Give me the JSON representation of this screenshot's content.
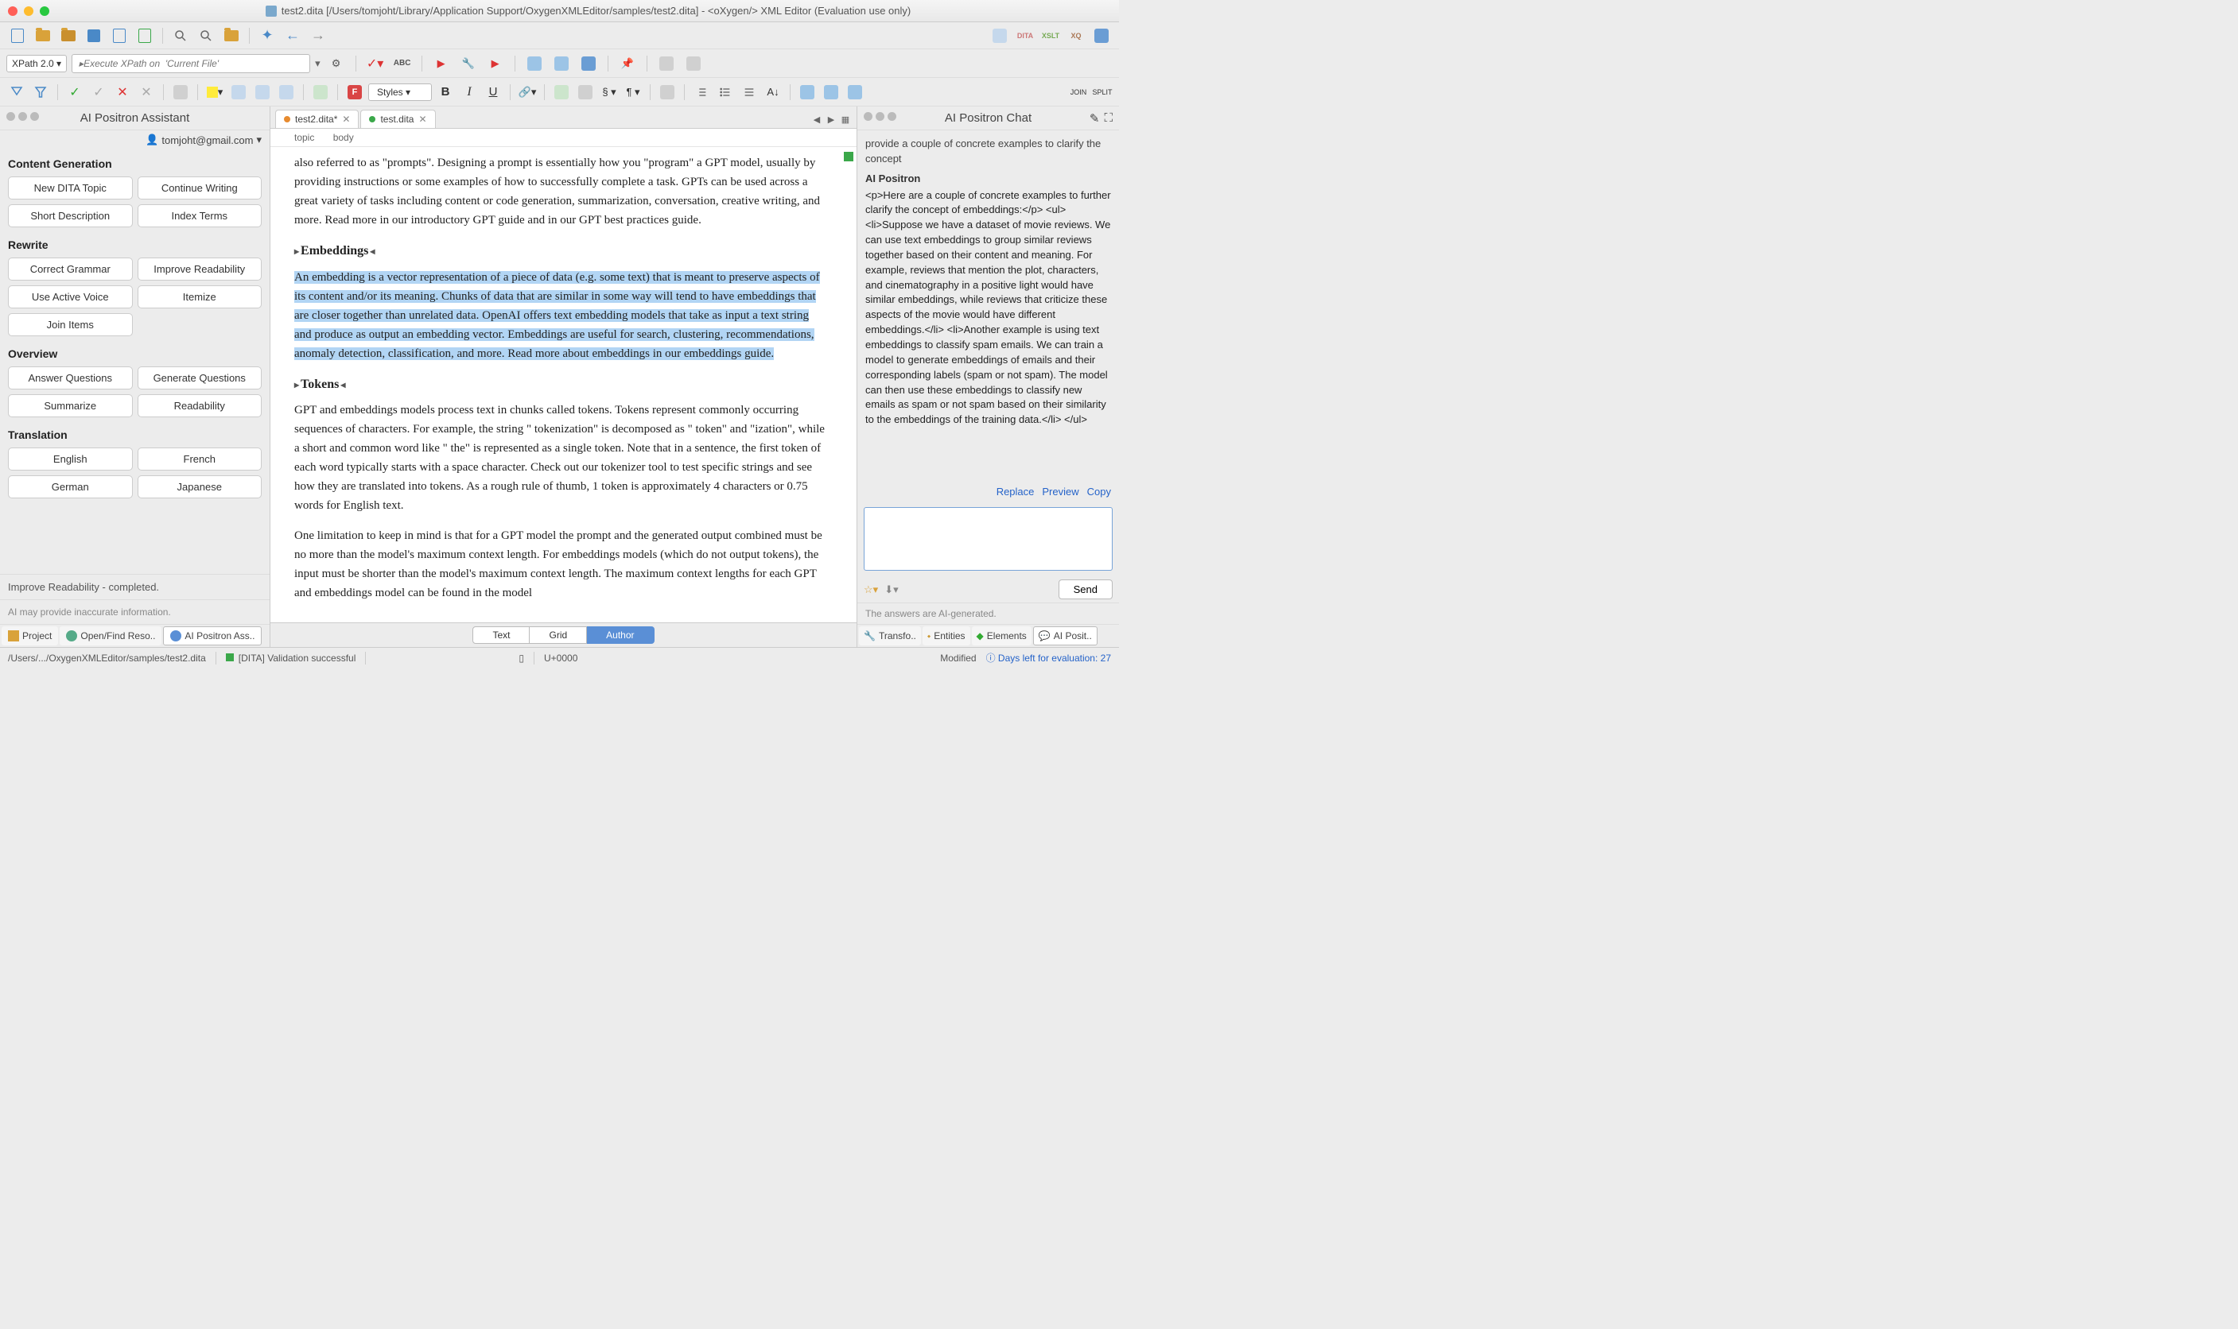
{
  "titlebar": {
    "title": "test2.dita [/Users/tomjoht/Library/Application Support/OxygenXMLEditor/samples/test2.dita] - <oXygen/> XML Editor (Evaluation use only)"
  },
  "xpath": {
    "version_label": "XPath 2.0 ▾",
    "placeholder": "▸Execute XPath on  'Current File'"
  },
  "styles": {
    "dropdown": "Styles     ▾"
  },
  "left": {
    "panel_title": "AI Positron Assistant",
    "user": "tomjoht@gmail.com",
    "sections": {
      "content_gen": "Content Generation",
      "rewrite": "Rewrite",
      "overview": "Overview",
      "translation": "Translation"
    },
    "buttons": {
      "new_topic": "New DITA Topic",
      "continue_writing": "Continue Writing",
      "short_desc": "Short Description",
      "index_terms": "Index Terms",
      "correct_grammar": "Correct Grammar",
      "improve_readability": "Improve Readability",
      "use_active_voice": "Use Active Voice",
      "itemize": "Itemize",
      "join_items": "Join Items",
      "answer_questions": "Answer Questions",
      "generate_questions": "Generate Questions",
      "summarize": "Summarize",
      "readability": "Readability",
      "english": "English",
      "french": "French",
      "german": "German",
      "japanese": "Japanese"
    },
    "status": "Improve Readability - completed.",
    "disclaimer": "AI may provide inaccurate information.",
    "tabs": {
      "project": "Project",
      "open_find": "Open/Find Reso..",
      "positron": "AI Positron Ass.."
    }
  },
  "editor": {
    "tabs": {
      "test2": "test2.dita*",
      "test": "test.dita"
    },
    "breadcrumb": {
      "a": "topic",
      "b": "body"
    },
    "para1": "also referred to as \"prompts\". Designing a prompt is essentially how you \"program\" a GPT model, usually by providing instructions or some examples of how to successfully complete a task. GPTs can be used across a great variety of tasks including content or code generation, summarization, conversation, creative writing, and more. Read more in our introductory GPT guide and in our GPT best practices guide.",
    "h_embed": "Embeddings",
    "para2": "An embedding is a vector representation of a piece of data (e.g. some text) that is meant to preserve aspects of its content and/or its meaning. Chunks of data that are similar in some way will tend to have embeddings that are closer together than unrelated data. OpenAI offers text embedding models that take as input a text string and produce as output an embedding vector. Embeddings are useful for search, clustering, recommendations, anomaly detection, classification, and more. Read more about embeddings in our embeddings guide.",
    "h_tokens": "Tokens",
    "para3": "GPT and embeddings models process text in chunks called tokens. Tokens represent commonly occurring sequences of characters. For example, the string \" tokenization\" is decomposed as \" token\" and \"ization\", while a short and common word like \" the\" is represented as a single token. Note that in a sentence, the first token of each word typically starts with a space character. Check out our tokenizer tool to test specific strings and see how they are translated into tokens. As a rough rule of thumb, 1 token is approximately 4 characters or 0.75 words for English text.",
    "para4": "One limitation to keep in mind is that for a GPT model the prompt and the generated output combined must be no more than the model's maximum context length. For embeddings models (which do not output tokens), the input must be shorter than the model's maximum context length. The maximum context lengths for each GPT and embeddings model can be found in the model",
    "modes": {
      "text": "Text",
      "grid": "Grid",
      "author": "Author"
    }
  },
  "chat": {
    "title": "AI Positron Chat",
    "prompt": "provide a couple of concrete examples to clarify the concept",
    "responder": "AI Positron",
    "response": "<p>Here are a couple of concrete examples to further clarify the concept of embeddings:</p>\n<ul>\n<li>Suppose we have a dataset of movie reviews. We can use text embeddings to group similar reviews together based on their content and meaning. For example, reviews that mention the plot, characters, and cinematography in a positive light would have similar embeddings, while reviews that criticize these aspects of the movie would have different embeddings.</li>\n<li>Another example is using text embeddings to classify spam emails. We can train a model to generate embeddings of emails and their corresponding labels (spam or not spam). The model can then use these embeddings to classify new emails as spam or not spam based on their similarity to the embeddings of the training data.</li>\n</ul>",
    "actions": {
      "replace": "Replace",
      "preview": "Preview",
      "copy": "Copy"
    },
    "send": "Send",
    "disclaimer": "The answers are AI-generated.",
    "tabs": {
      "transfo": "Transfo..",
      "entities": "Entities",
      "elements": "Elements",
      "positron": "AI Posit.."
    }
  },
  "statusbar": {
    "path": "/Users/.../OxygenXMLEditor/samples/test2.dita",
    "validation": "[DITA] Validation successful",
    "unicode": "U+0000",
    "modified": "Modified",
    "eval": "Days left for evaluation: 27"
  }
}
